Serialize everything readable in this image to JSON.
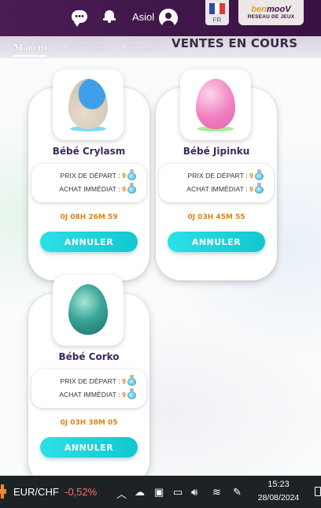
{
  "header": {
    "username": "Asiol",
    "language_code": "FR",
    "logo_brand_prefix": "ben",
    "logo_brand": "mooV",
    "logo_subtitle": "RESEAU DE JEUX"
  },
  "nav": {
    "items": [
      {
        "label": "Marché",
        "active": true
      },
      {
        "label": "Boutiques",
        "active": false
      },
      {
        "label": "Recharge",
        "active": false
      }
    ],
    "section_title": "VENTES EN COURS"
  },
  "sales": [
    {
      "name": "Bébé Crylasm",
      "start_price_label": "PRIX DE DÉPART :",
      "start_price": "9",
      "buyout_label": "ACHAT IMMÉDIAT :",
      "buyout_price": "9",
      "timer": "0J 08H 26M 59",
      "cancel_label": "ANNULER",
      "egg_color": "#4aa9e6"
    },
    {
      "name": "Bébé Jipinku",
      "start_price_label": "PRIX DE DÉPART :",
      "start_price": "9",
      "buyout_label": "ACHAT IMMÉDIAT :",
      "buyout_price": "9",
      "timer": "0J 03H 45M 55",
      "cancel_label": "ANNULER",
      "egg_color": "#f08ac2"
    },
    {
      "name": "Bébé Corko",
      "start_price_label": "PRIX DE DÉPART :",
      "start_price": "9",
      "buyout_label": "ACHAT IMMÉDIAT :",
      "buyout_price": "9",
      "timer": "0J 03H 38M 05",
      "cancel_label": "ANNULER",
      "egg_color": "#2f8f86"
    }
  ],
  "taskbar": {
    "ticker_pair": "EUR/CHF",
    "ticker_change": "-0,52%",
    "time": "15:23",
    "date": "28/08/2024"
  },
  "colors": {
    "header_bg": "#3d1546",
    "accent_button": "#1ed2d9",
    "timer": "#e0820f",
    "price_value": "#e07b10"
  }
}
